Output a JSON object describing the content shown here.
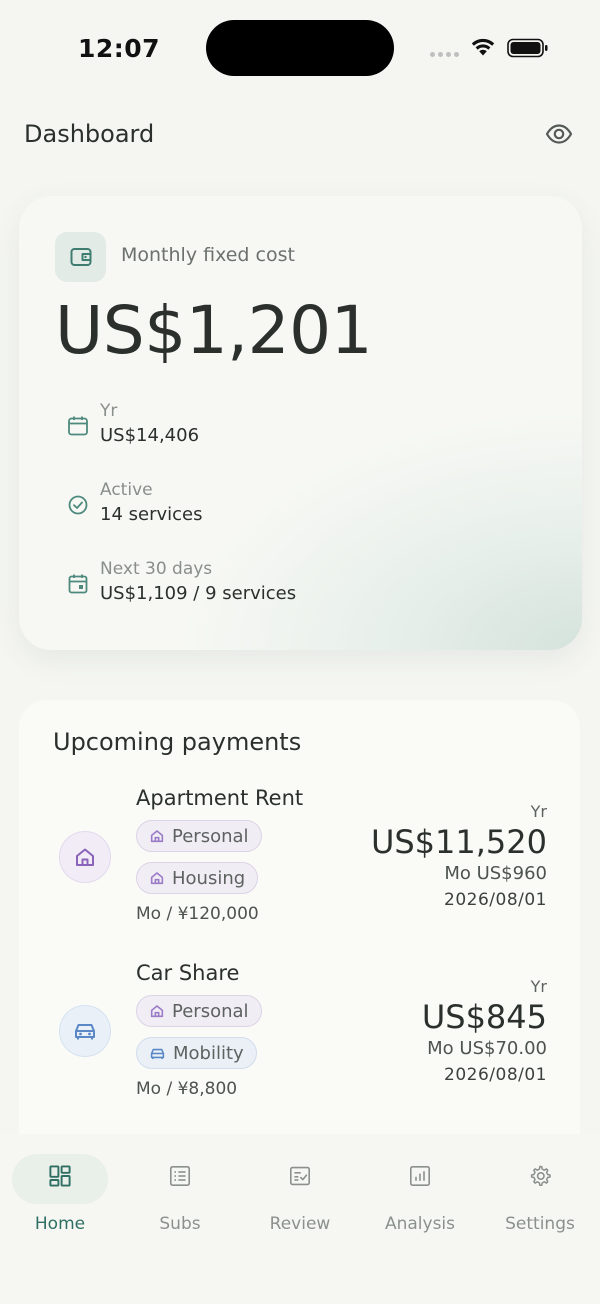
{
  "status_bar": {
    "time": "12:07"
  },
  "header": {
    "title": "Dashboard"
  },
  "summary": {
    "caption": "Monthly fixed cost",
    "amount": "US$1,201",
    "stats": [
      {
        "label": "Yr",
        "value": "US$14,406",
        "icon": "calendar-icon"
      },
      {
        "label": "Active",
        "value": "14 services",
        "icon": "check-circle-icon"
      },
      {
        "label": "Next 30 days",
        "value": "US$1,109 / 9 services",
        "icon": "calendar-event-icon"
      }
    ]
  },
  "upcoming": {
    "title": "Upcoming payments",
    "items": [
      {
        "name": "Apartment Rent",
        "icon": "home-icon",
        "tags": [
          {
            "label": "Personal",
            "icon": "home-icon"
          },
          {
            "label": "Housing",
            "icon": "home-icon"
          }
        ],
        "monthly_original": "Mo / ¥120,000",
        "yr_label": "Yr",
        "yearly": "US$11,520",
        "monthly": "Mo US$960",
        "date": "2026/08/01"
      },
      {
        "name": "Car Share",
        "icon": "car-icon",
        "tags": [
          {
            "label": "Personal",
            "icon": "home-icon"
          },
          {
            "label": "Mobility",
            "icon": "car-icon"
          }
        ],
        "monthly_original": "Mo / ¥8,800",
        "yr_label": "Yr",
        "yearly": "US$845",
        "monthly": "Mo US$70.00",
        "date": "2026/08/01"
      }
    ]
  },
  "nav": [
    {
      "label": "Home",
      "icon": "dashboard-grid-icon",
      "active": true
    },
    {
      "label": "Subs",
      "icon": "list-icon",
      "active": false
    },
    {
      "label": "Review",
      "icon": "review-icon",
      "active": false
    },
    {
      "label": "Analysis",
      "icon": "bar-chart-icon",
      "active": false
    },
    {
      "label": "Settings",
      "icon": "gear-icon",
      "active": false
    }
  ],
  "colors": {
    "accent": "#2f6f63",
    "background": "#f5f6f2",
    "purple_tag": "#f1edf5",
    "blue_tag": "#eaf0f6"
  }
}
